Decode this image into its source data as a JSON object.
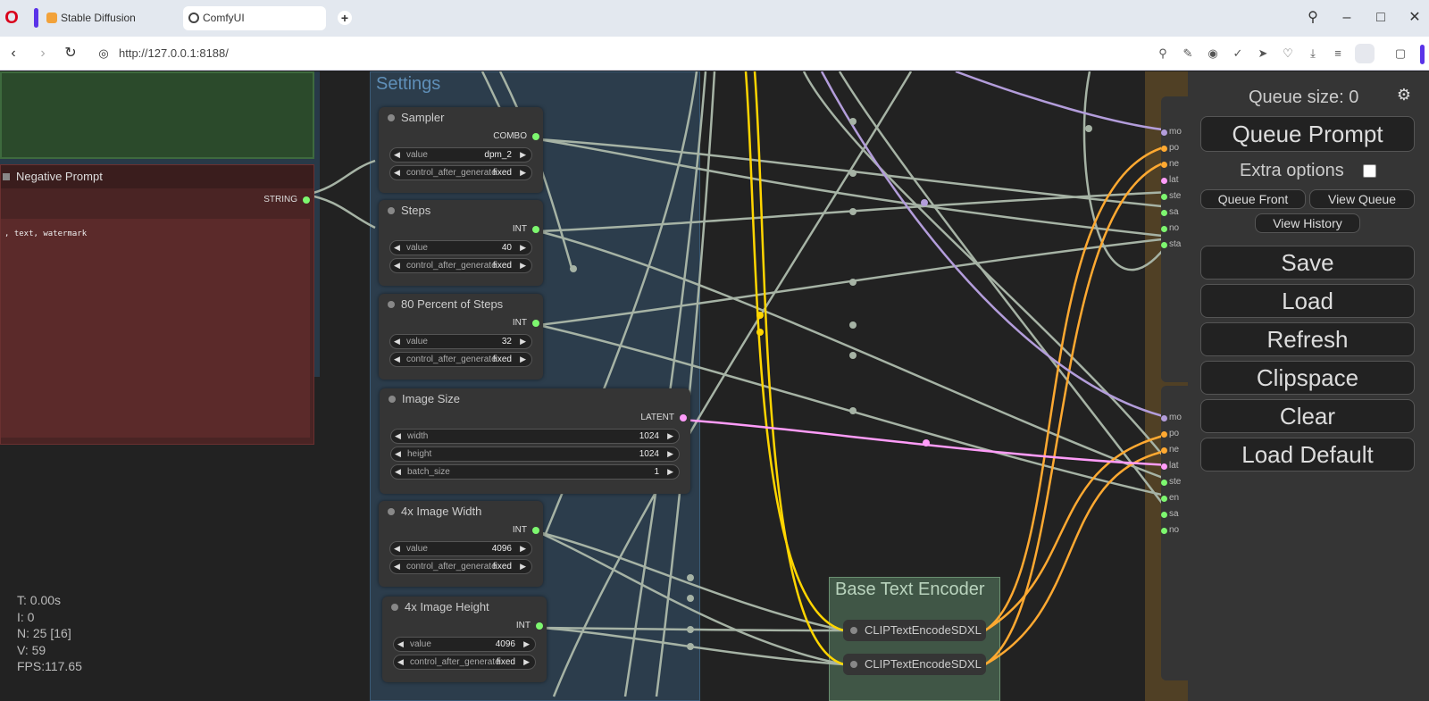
{
  "browser": {
    "tabs": [
      {
        "label": "Stable Diffusion"
      },
      {
        "label": "ComfyUI"
      }
    ],
    "url": "http://127.0.0.1:8188/"
  },
  "canvas": {
    "groups": {
      "settings": "Settings",
      "base_text_encoder": "Base Text Encoder"
    },
    "negative_prompt": {
      "title": "Negative Prompt",
      "output": "STRING",
      "text": ", text, watermark"
    },
    "nodes": {
      "sampler": {
        "title": "Sampler",
        "output": "COMBO",
        "value_label": "value",
        "value": "dpm_2",
        "control_label": "control_after_generate",
        "control_value": "fixed"
      },
      "steps": {
        "title": "Steps",
        "output": "INT",
        "value_label": "value",
        "value": "40",
        "control_label": "control_after_generate",
        "control_value": "fixed"
      },
      "percent": {
        "title": "80 Percent of Steps",
        "output": "INT",
        "value_label": "value",
        "value": "32",
        "control_label": "control_after_generate",
        "control_value": "fixed"
      },
      "image_size": {
        "title": "Image Size",
        "output": "LATENT",
        "width_label": "width",
        "width": "1024",
        "height_label": "height",
        "height": "1024",
        "batch_label": "batch_size",
        "batch": "1"
      },
      "width4x": {
        "title": "4x Image Width",
        "output": "INT",
        "value_label": "value",
        "value": "4096",
        "control_label": "control_after_generate",
        "control_value": "fixed"
      },
      "height4x": {
        "title": "4x Image Height",
        "output": "INT",
        "value_label": "value",
        "value": "4096",
        "control_label": "control_after_generate",
        "control_value": "fixed"
      }
    },
    "clip_nodes": [
      "CLIPTextEncodeSDXL",
      "CLIPTextEncodeSDXL"
    ],
    "right_ports_top": [
      "mo",
      "po",
      "ne",
      "lat",
      "ste",
      "sa",
      "no",
      "sta"
    ],
    "right_ports_bottom": [
      "mo",
      "po",
      "ne",
      "lat",
      "ste",
      "en",
      "sa",
      "no"
    ],
    "stats": {
      "t": "T: 0.00s",
      "i": "I: 0",
      "n": "N: 25 [16]",
      "v": "V: 59",
      "fps": "FPS:117.65"
    }
  },
  "menu": {
    "queue_size": "Queue size: 0",
    "queue_prompt": "Queue Prompt",
    "extra_options": "Extra options",
    "queue_front": "Queue Front",
    "view_queue": "View Queue",
    "view_history": "View History",
    "save": "Save",
    "load": "Load",
    "refresh": "Refresh",
    "clipspace": "Clipspace",
    "clear": "Clear",
    "load_default": "Load Default"
  },
  "colors": {
    "int_wire": "#a6b3a5",
    "clip_wire": "#ffd500",
    "conditioning_wire": "#ffa931",
    "model_wire": "#b39ddb",
    "latent_wire": "#ff9cf9"
  }
}
